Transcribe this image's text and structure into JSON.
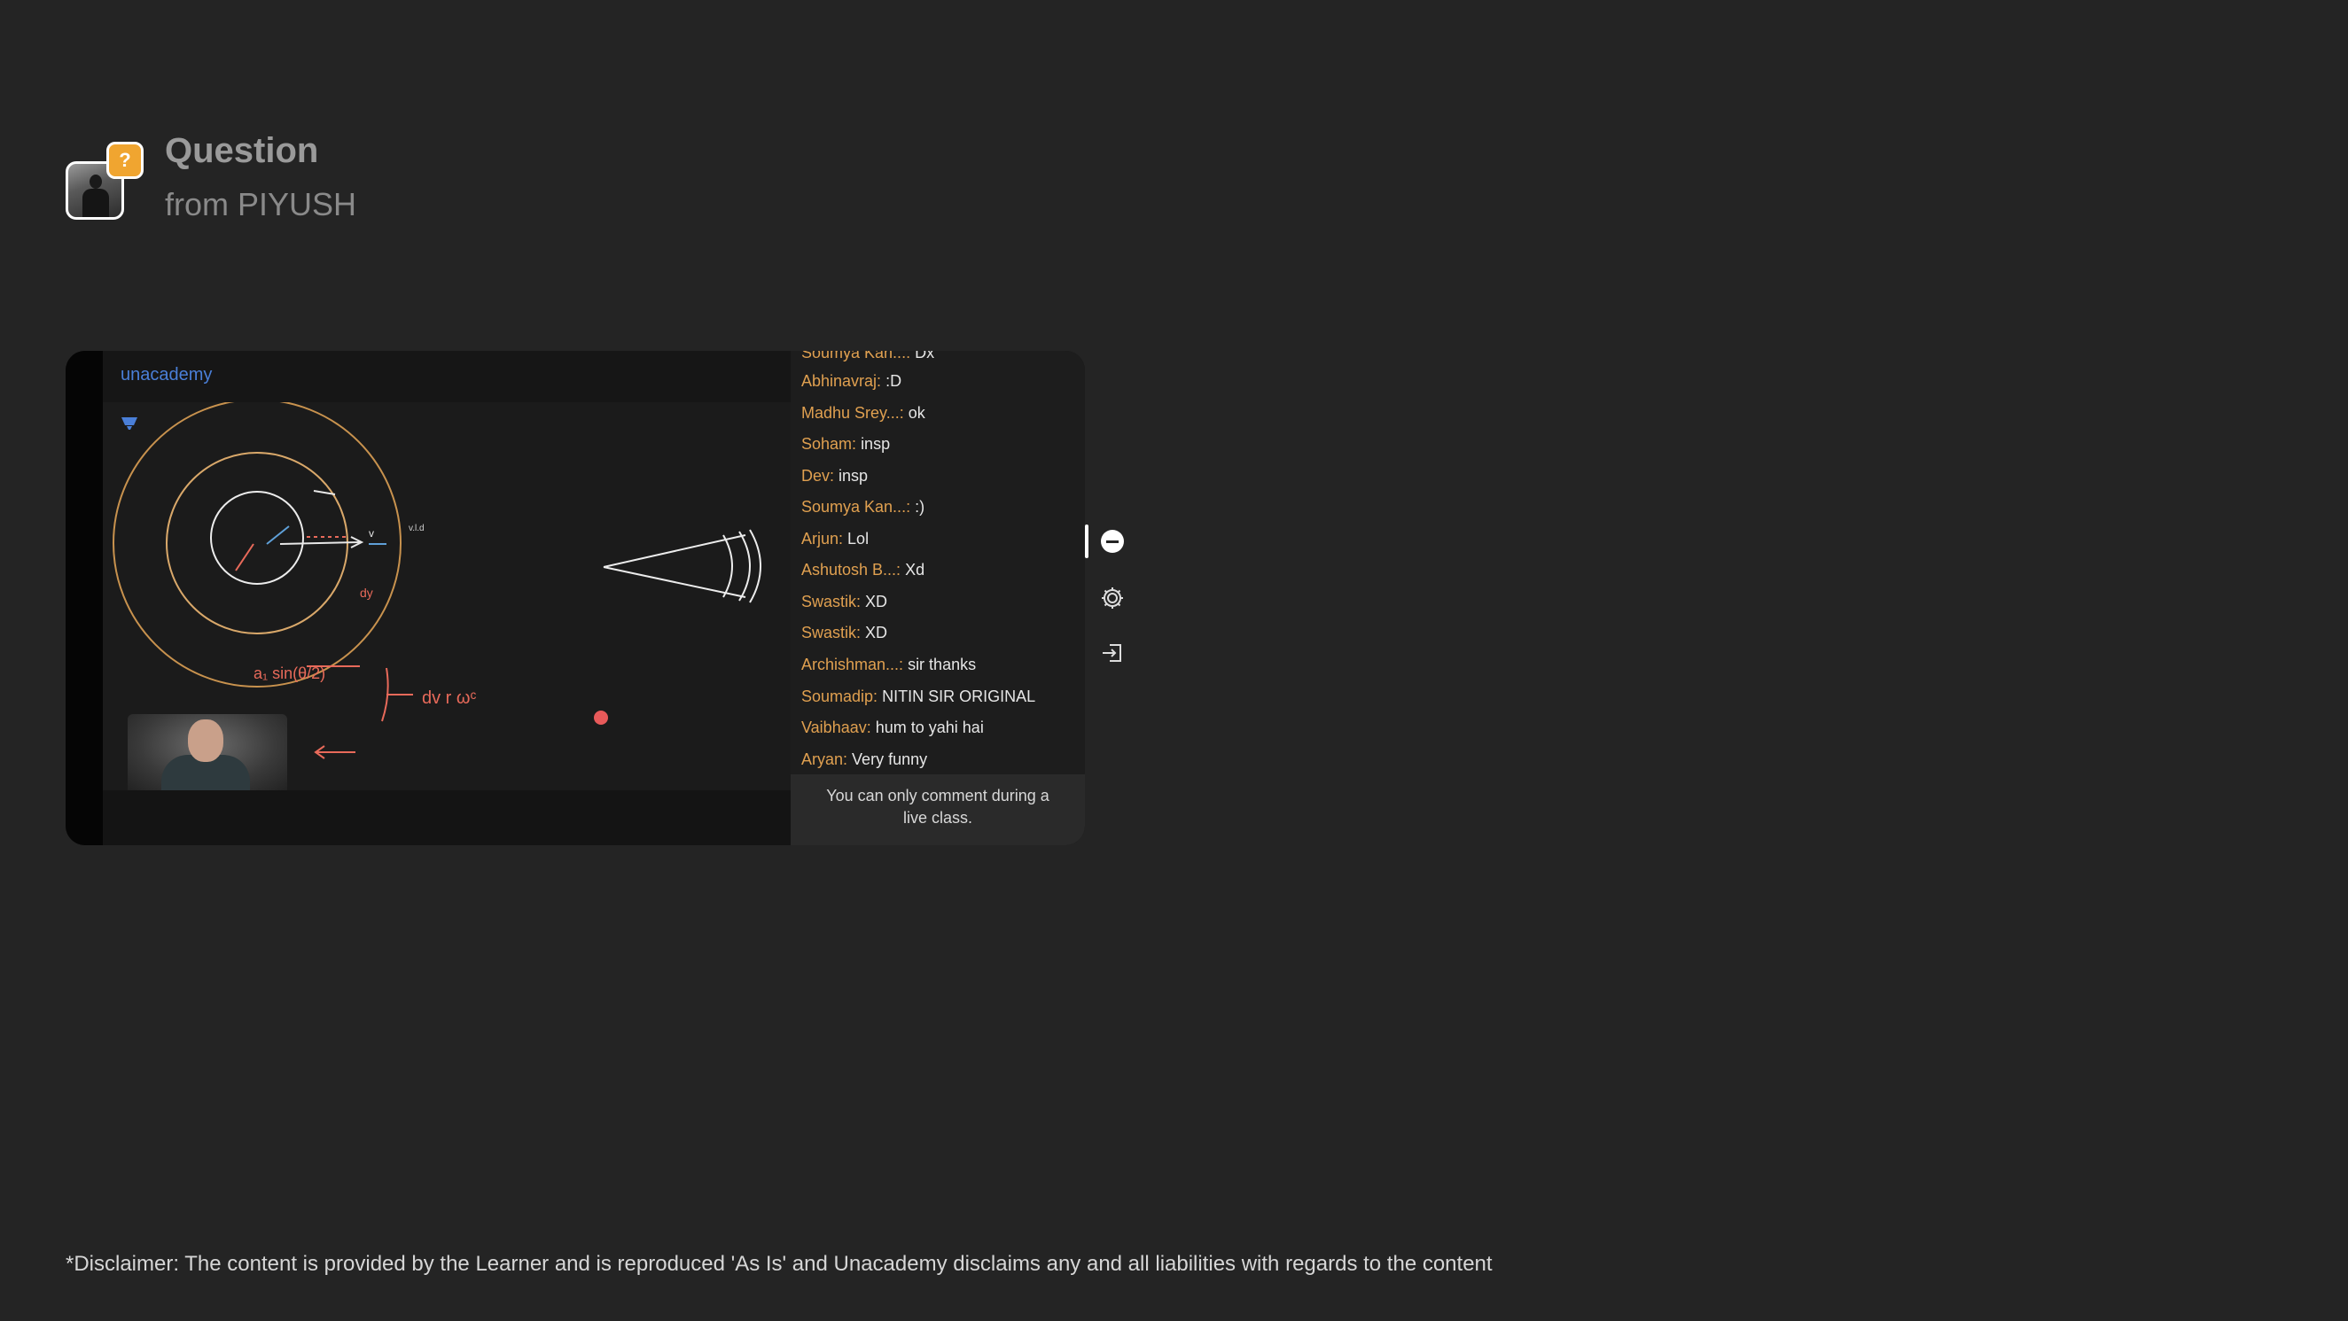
{
  "header": {
    "title": "Question",
    "subtitle": "from PIYUSH",
    "badge_symbol": "?"
  },
  "player": {
    "brand": "unacademy",
    "chat": {
      "messages": [
        {
          "name": "Soumya Kan...:",
          "text": "Dx"
        },
        {
          "name": "Abhinavraj:",
          "text": ":D"
        },
        {
          "name": "Madhu Srey...:",
          "text": "ok"
        },
        {
          "name": "Soham:",
          "text": "insp"
        },
        {
          "name": "Dev:",
          "text": "insp"
        },
        {
          "name": "Soumya Kan...:",
          "text": ":)"
        },
        {
          "name": "Arjun:",
          "text": "Lol"
        },
        {
          "name": "Ashutosh B...:",
          "text": "Xd"
        },
        {
          "name": "Swastik:",
          "text": "XD"
        },
        {
          "name": "Swastik:",
          "text": "XD"
        },
        {
          "name": "Archishman...:",
          "text": "sir thanks"
        },
        {
          "name": "Soumadip:",
          "text": "NITIN SIR ORIGINAL"
        },
        {
          "name": "Vaibhaav:",
          "text": "hum to yahi hai"
        },
        {
          "name": "Aryan:",
          "text": "Very funny"
        }
      ],
      "footer_note": "You can only comment during a live class."
    },
    "side_controls": [
      {
        "icon": "chat-icon",
        "active": true
      },
      {
        "icon": "gear-icon",
        "active": false
      },
      {
        "icon": "exit-icon",
        "active": false
      }
    ]
  },
  "colors": {
    "background": "#242424",
    "badge": "#f0a530",
    "chat_name": "#e0a050",
    "brand": "#4a7fd8"
  },
  "disclaimer": "*Disclaimer: The content is provided by the Learner and is reproduced 'As Is' and Unacademy disclaims any and all liabilities with regards to the content"
}
